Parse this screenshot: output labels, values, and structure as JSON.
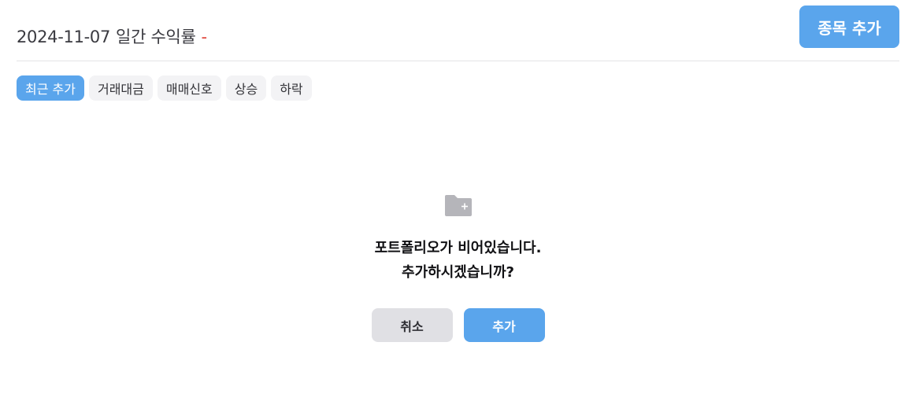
{
  "header": {
    "date": "2024-11-07",
    "title_label": "일간 수익률",
    "return_value": "-",
    "add_stock_label": "종목 추가"
  },
  "tabs": [
    {
      "label": "최근 추가",
      "active": true
    },
    {
      "label": "거래대금",
      "active": false
    },
    {
      "label": "매매신호",
      "active": false
    },
    {
      "label": "상승",
      "active": false
    },
    {
      "label": "하락",
      "active": false
    }
  ],
  "empty_state": {
    "icon": "folder-plus-icon",
    "line1": "포트폴리오가 비어있습니다.",
    "line2": "추가하시겠습니까?",
    "cancel_label": "취소",
    "confirm_label": "추가"
  },
  "colors": {
    "accent": "#5aa5ec",
    "negative": "#e0453a",
    "tab_bg": "#f3f3f5",
    "cancel_bg": "#e0e0e4",
    "icon_gray": "#b5b5ba"
  }
}
